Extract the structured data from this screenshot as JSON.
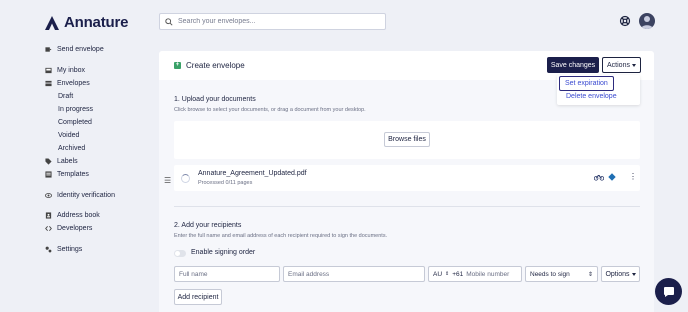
{
  "app": {
    "name": "Annature"
  },
  "search": {
    "placeholder": "Search your envelopes..."
  },
  "sidebar": {
    "send_envelope": "Send envelope",
    "my_inbox": "My inbox",
    "envelopes": "Envelopes",
    "sub": [
      "Draft",
      "In progress",
      "Completed",
      "Voided",
      "Archived"
    ],
    "labels": "Labels",
    "templates": "Templates",
    "identity_verification": "Identity verification",
    "address_book": "Address book",
    "developers": "Developers",
    "settings": "Settings"
  },
  "header": {
    "title": "Create envelope",
    "save_label": "Save changes",
    "actions_label": "Actions"
  },
  "actions_menu": {
    "items": [
      "Set expiration",
      "Delete envelope"
    ],
    "highlighted": "Set expiration"
  },
  "upload": {
    "title": "1. Upload your documents",
    "hint": "Click browse to select your documents, or drag a document from your desktop.",
    "browse_label": "Browse files"
  },
  "document": {
    "name": "Annature_Agreement_Updated.pdf",
    "status": "Processed 0/11 pages"
  },
  "recipients": {
    "title": "2. Add your recipients",
    "hint": "Enter the full name and email address of each recipient required to sign the documents.",
    "signing_order_label": "Enable signing order",
    "full_name_placeholder": "Full name",
    "email_placeholder": "Email address",
    "country": "AU",
    "dial_code": "+61",
    "mobile_placeholder": "Mobile number",
    "role": "Needs to sign",
    "options_label": "Options",
    "add_label": "Add recipient"
  },
  "colors": {
    "brand": "#1b1f4b",
    "accent_link": "#3b4bd1",
    "success": "#3aa168",
    "background": "#eef0f6"
  }
}
